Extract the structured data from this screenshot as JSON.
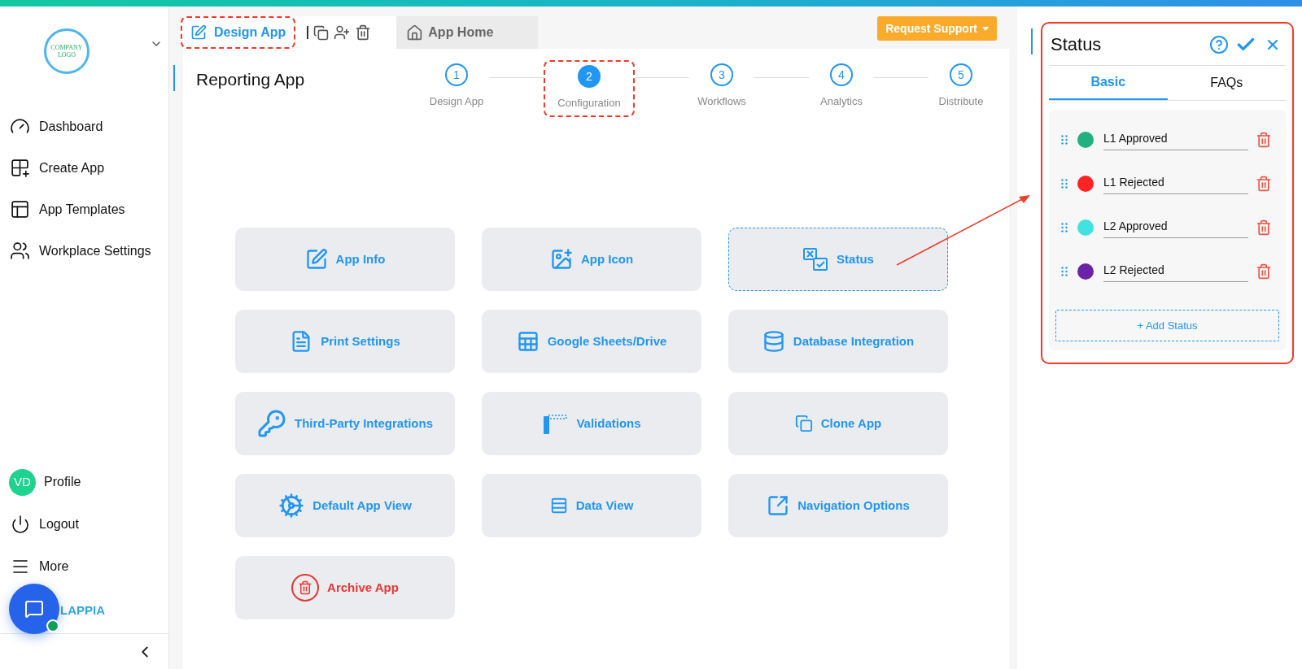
{
  "sidebar": {
    "logo_text": "COMPANY LOGO",
    "nav": [
      {
        "label": "Dashboard",
        "kind": "gauge"
      },
      {
        "label": "Create App",
        "kind": "grid-plus"
      },
      {
        "label": "App Templates",
        "kind": "template"
      },
      {
        "label": "Workplace Settings",
        "kind": "users"
      }
    ],
    "profile": {
      "initials": "VD",
      "label": "Profile"
    },
    "footer": [
      {
        "label": "Logout",
        "kind": "power"
      },
      {
        "label": "More",
        "kind": "menu"
      }
    ],
    "brand": "LAPPIA"
  },
  "header": {
    "tabs": [
      {
        "label": "Design App",
        "selected": true,
        "kind": "edit"
      },
      {
        "label": "App Home",
        "selected": false,
        "kind": "home"
      }
    ],
    "support_button": "Request Support"
  },
  "app_title": "Reporting App",
  "steps": [
    {
      "number": "1",
      "label": "Design App",
      "selected": false
    },
    {
      "number": "2",
      "label": "Configuration",
      "selected": true
    },
    {
      "number": "3",
      "label": "Workflows",
      "selected": false
    },
    {
      "number": "4",
      "label": "Analytics",
      "selected": false
    },
    {
      "number": "5",
      "label": "Distribute",
      "selected": false
    }
  ],
  "cards": [
    {
      "label": "App Info",
      "kind": "edit",
      "selected": false,
      "danger": false
    },
    {
      "label": "App Icon",
      "kind": "image",
      "selected": false,
      "danger": false
    },
    {
      "label": "Status",
      "kind": "status",
      "selected": true,
      "danger": false
    },
    {
      "label": "Print Settings",
      "kind": "pdf",
      "selected": false,
      "danger": false
    },
    {
      "label": "Google Sheets/Drive",
      "kind": "sheet",
      "selected": false,
      "danger": false
    },
    {
      "label": "Database Integration",
      "kind": "database",
      "selected": false,
      "danger": false
    },
    {
      "label": "Third-Party Integrations",
      "kind": "key",
      "selected": false,
      "danger": false
    },
    {
      "label": "Validations",
      "kind": "barrier",
      "selected": false,
      "danger": false
    },
    {
      "label": "Clone App",
      "kind": "copy",
      "selected": false,
      "danger": false
    },
    {
      "label": "Default App View",
      "kind": "gears",
      "selected": false,
      "danger": false
    },
    {
      "label": "Data View",
      "kind": "rows",
      "selected": false,
      "danger": false
    },
    {
      "label": "Navigation Options",
      "kind": "external",
      "selected": false,
      "danger": false
    },
    {
      "label": "Archive App",
      "kind": "trash",
      "selected": false,
      "danger": true
    }
  ],
  "panel": {
    "title": "Status",
    "tabs": [
      {
        "label": "Basic",
        "selected": true
      },
      {
        "label": "FAQs",
        "selected": false
      }
    ],
    "statuses": [
      {
        "name": "L1 Approved",
        "color": "#21b07f"
      },
      {
        "name": "L1 Rejected",
        "color": "#ff2424"
      },
      {
        "name": "L2 Approved",
        "color": "#40e3e0"
      },
      {
        "name": "L2 Rejected",
        "color": "#6a23a6"
      }
    ],
    "add_button": "+ Add Status"
  }
}
